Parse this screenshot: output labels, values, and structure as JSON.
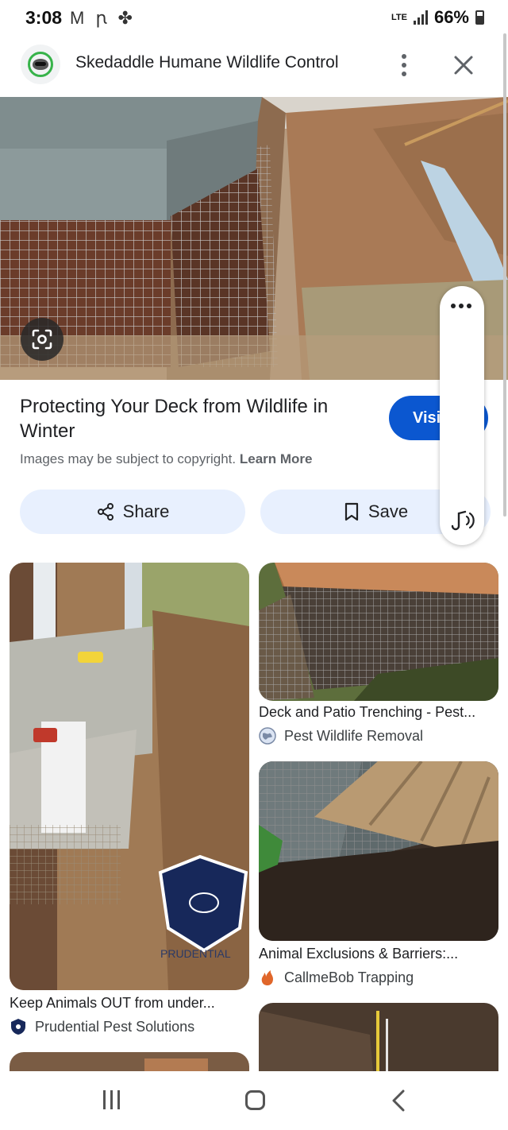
{
  "status_bar": {
    "time": "3:08",
    "notification_icons": "M ꞃ ✤",
    "network_label": "LTE",
    "battery": "66%"
  },
  "header": {
    "site_name": "Skedaddle Humane Wildlife Control"
  },
  "result": {
    "title": "Protecting Your Deck from Wildlife in Winter",
    "visit_label": "Visi",
    "copyright_text": "Images may be subject to copyright. ",
    "learn_more": "Learn More",
    "share_label": "Share",
    "save_label": "Save"
  },
  "related": [
    {
      "title": "Keep Animals OUT from under...",
      "source": "Prudential Pest Solutions",
      "logo_text": "PRUDENTIAL"
    },
    {
      "title": "Deck and Patio Trenching - Pest...",
      "source": "Pest Wildlife Removal"
    },
    {
      "title": "Animal Exclusions & Barriers:...",
      "source": "CallmeBob Trapping"
    }
  ],
  "colors": {
    "accent": "#0b57d0",
    "button_bg": "#e8f0fe",
    "text_primary": "#202124",
    "text_secondary": "#5f6368"
  },
  "icons": [
    "raccoon-logo-icon",
    "more-vert-icon",
    "close-icon",
    "lens-icon",
    "share-icon",
    "bookmark-icon",
    "more-horiz-icon",
    "audio-icon",
    "globe-icon",
    "shield-icon",
    "flame-icon",
    "recents-icon",
    "home-icon",
    "back-icon"
  ]
}
